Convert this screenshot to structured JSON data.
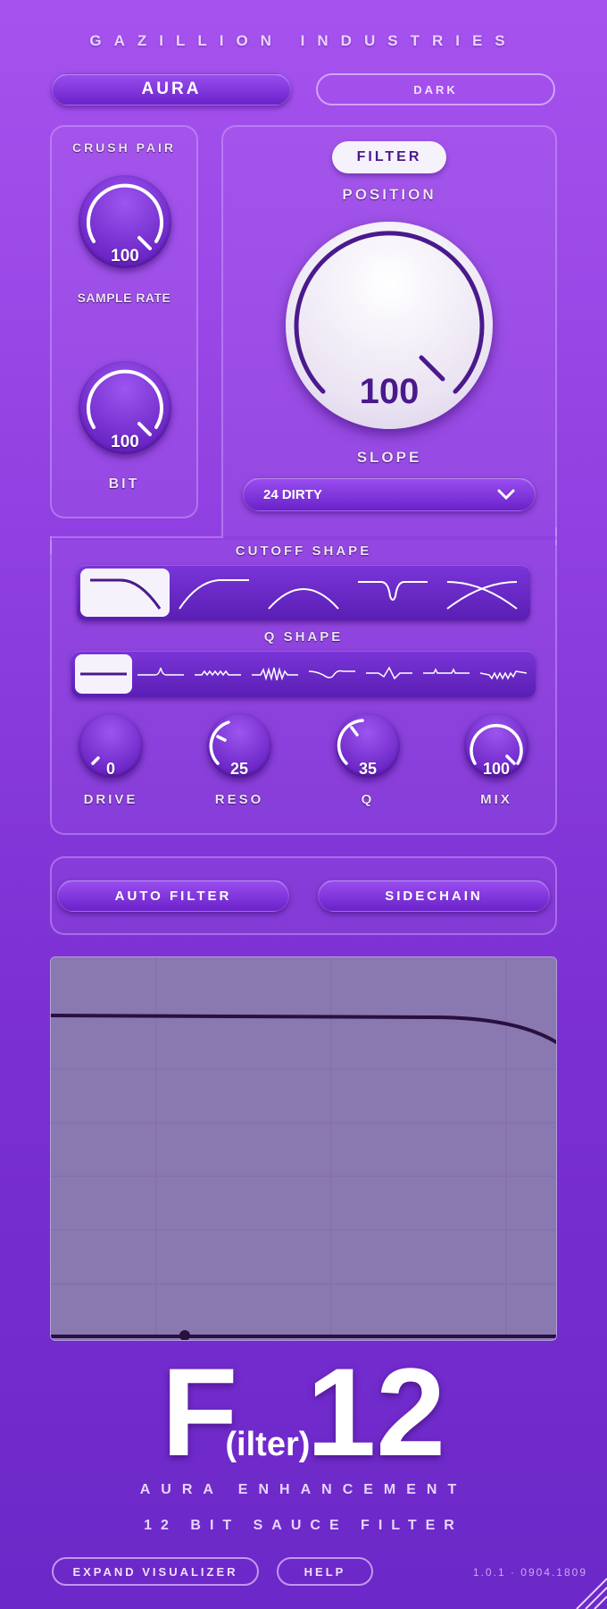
{
  "brand": "GAZILLION INDUSTRIES",
  "header": {
    "preset_label": "AURA",
    "theme_label": "DARK"
  },
  "crush": {
    "title": "CRUSH PAIR",
    "sample_rate": {
      "label": "SAMPLE RATE",
      "value": "100"
    },
    "bit": {
      "label": "BIT",
      "value": "100"
    }
  },
  "filter": {
    "tab_label": "FILTER",
    "position_label": "POSITION",
    "position_value": "100",
    "slope_label": "SLOPE",
    "slope_value": "24 DIRTY"
  },
  "cutoff_shape": {
    "title": "CUTOFF SHAPE",
    "options": [
      "lowpass",
      "highpass",
      "bandpass",
      "notch",
      "crossover"
    ],
    "selected_index": 0
  },
  "q_shape": {
    "title": "Q SHAPE",
    "options": [
      "flat",
      "peak",
      "ripple",
      "jagged",
      "wave",
      "zigzag",
      "steps",
      "noise"
    ],
    "selected_index": 0
  },
  "knobs": [
    {
      "label": "DRIVE",
      "value": "0"
    },
    {
      "label": "RESO",
      "value": "25"
    },
    {
      "label": "Q",
      "value": "35"
    },
    {
      "label": "MIX",
      "value": "100"
    }
  ],
  "modes": {
    "auto_filter": "AUTO FILTER",
    "sidechain": "SIDECHAIN"
  },
  "logo": {
    "big_f": "F",
    "sub": "(ilter)",
    "num": "12"
  },
  "tagline1": "AURA ENHANCEMENT",
  "tagline2": "12 BIT SAUCE FILTER",
  "footer": {
    "expand": "EXPAND VISUALIZER",
    "help": "HELP",
    "version": "1.0.1 · 0904.1809"
  },
  "colors": {
    "accent": "#4a1a8c",
    "panel_border": "#d2aaff",
    "viz_bg": "#8a78b0"
  }
}
